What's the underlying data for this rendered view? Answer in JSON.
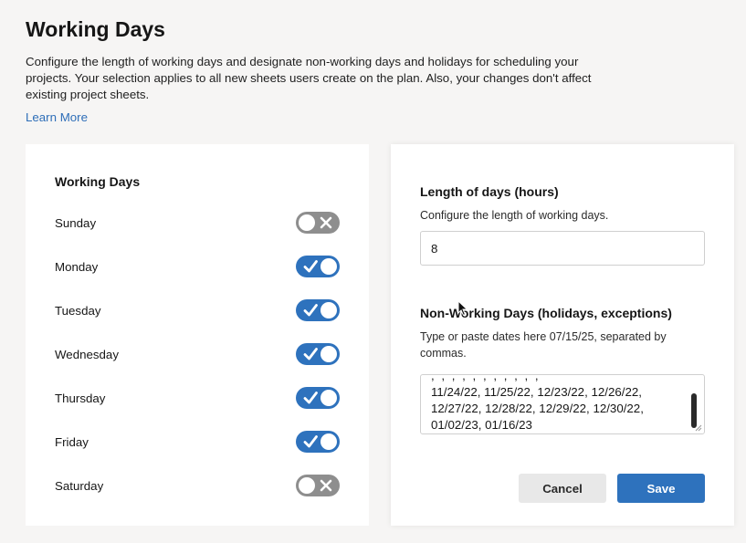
{
  "page": {
    "title": "Working Days",
    "description": "Configure the length of working days and designate non-working days and holidays for scheduling your projects. Your selection applies to all new sheets users create on the plan. Also, your changes don't affect existing project sheets.",
    "learn_more": "Learn More"
  },
  "working_days": {
    "title": "Working Days",
    "days": [
      {
        "label": "Sunday",
        "enabled": false
      },
      {
        "label": "Monday",
        "enabled": true
      },
      {
        "label": "Tuesday",
        "enabled": true
      },
      {
        "label": "Wednesday",
        "enabled": true
      },
      {
        "label": "Thursday",
        "enabled": true
      },
      {
        "label": "Friday",
        "enabled": true
      },
      {
        "label": "Saturday",
        "enabled": false
      }
    ]
  },
  "length": {
    "title": "Length of days (hours)",
    "description": "Configure the length of working days.",
    "value": "8"
  },
  "non_working": {
    "title": "Non-Working Days (holidays, exceptions)",
    "description": "Type or paste dates here 07/15/25, separated by commas.",
    "visible_lines": [
      ", , , , , , , , , , ,",
      "11/24/22, 11/25/22, 12/23/22, 12/26/22,",
      "12/27/22, 12/28/22, 12/29/22, 12/30/22,",
      "01/02/23, 01/16/23"
    ]
  },
  "actions": {
    "cancel_label": "Cancel",
    "save_label": "Save"
  },
  "colors": {
    "accent": "#2e72bd",
    "toggle_off": "#8e8e8e",
    "link": "#2e6eb8",
    "background": "#f6f5f4"
  }
}
